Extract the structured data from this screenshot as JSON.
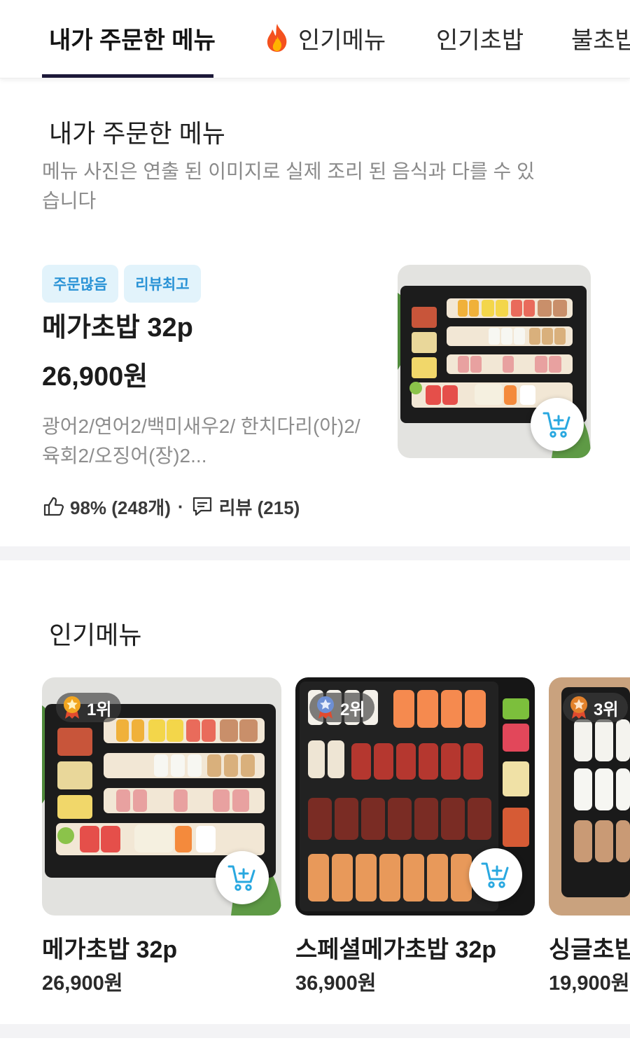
{
  "tabs": [
    {
      "label": "내가 주문한 메뉴",
      "active": true
    },
    {
      "label": "인기메뉴",
      "icon": "fire-icon"
    },
    {
      "label": "인기초밥"
    },
    {
      "label": "불초밥"
    }
  ],
  "my_menu": {
    "title": "내가 주문한 메뉴",
    "notice": "메뉴 사진은 연출 된 이미지로 실제 조리 된 음식과 다를 수 있습니다",
    "item": {
      "badges": [
        "주문많음",
        "리뷰최고"
      ],
      "name": "메가초밥 32p",
      "price": "26,900원",
      "description": "광어2/연어2/백미새우2/ 한치다리(아)2/육회2/오징어(장)2...",
      "like_rate": "98% (248개)",
      "separator": "·",
      "reviews": "리뷰 (215)"
    }
  },
  "popular": {
    "title": "인기메뉴",
    "items": [
      {
        "rank": "1위",
        "medal_color": "#f2a51f",
        "name": "메가초밥 32p",
        "price": "26,900원"
      },
      {
        "rank": "2위",
        "medal_color": "#6d8fd4",
        "name": "스페셜메가초밥 32p",
        "price": "36,900원"
      },
      {
        "rank": "3위",
        "medal_color": "#e2812b",
        "name": "싱글초밥",
        "price": "19,900원"
      }
    ]
  },
  "colors": {
    "accent_underline": "#1c1838",
    "badge_bg": "#e2f3fb",
    "badge_text": "#2a93d6",
    "cart_icon": "#29a8e0"
  }
}
